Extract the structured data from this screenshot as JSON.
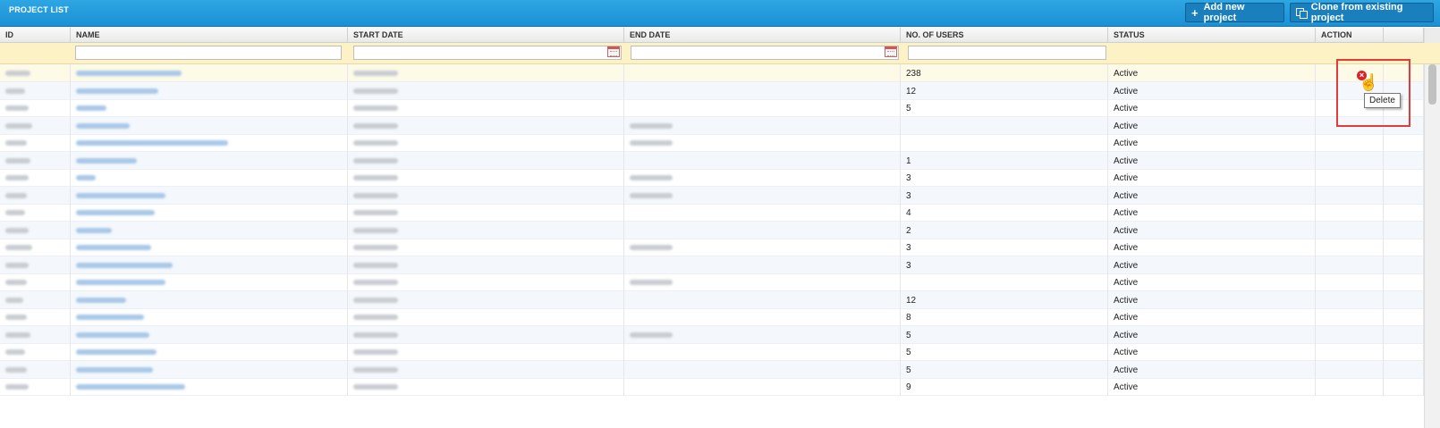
{
  "titlebar": {
    "title": "PROJECT LIST",
    "add_label": "Add new project",
    "clone_label": "Clone from existing project"
  },
  "columns": {
    "id": "ID",
    "name": "NAME",
    "start_date": "START DATE",
    "end_date": "END DATE",
    "users": "NO. OF USERS",
    "status": "STATUS",
    "action": "ACTION"
  },
  "rows": [
    {
      "users": "238",
      "status": "Active",
      "end": false
    },
    {
      "users": "12",
      "status": "Active",
      "end": false
    },
    {
      "users": "5",
      "status": "Active",
      "end": false
    },
    {
      "users": "",
      "status": "Active",
      "end": true
    },
    {
      "users": "",
      "status": "Active",
      "end": true
    },
    {
      "users": "1",
      "status": "Active",
      "end": false
    },
    {
      "users": "3",
      "status": "Active",
      "end": true
    },
    {
      "users": "3",
      "status": "Active",
      "end": true
    },
    {
      "users": "4",
      "status": "Active",
      "end": false
    },
    {
      "users": "2",
      "status": "Active",
      "end": false
    },
    {
      "users": "3",
      "status": "Active",
      "end": true
    },
    {
      "users": "3",
      "status": "Active",
      "end": false
    },
    {
      "users": "",
      "status": "Active",
      "end": true
    },
    {
      "users": "12",
      "status": "Active",
      "end": false
    },
    {
      "users": "8",
      "status": "Active",
      "end": false
    },
    {
      "users": "5",
      "status": "Active",
      "end": true
    },
    {
      "users": "5",
      "status": "Active",
      "end": false
    },
    {
      "users": "5",
      "status": "Active",
      "end": false
    },
    {
      "users": "9",
      "status": "Active",
      "end": false
    }
  ],
  "tooltip": "Delete",
  "colors": {
    "titlebar": "#1991d4",
    "button": "#1a7fbd",
    "filter_bg": "#fdf2c5",
    "highlight": "#e23b3b",
    "link_blur": "#a9c8e8"
  }
}
